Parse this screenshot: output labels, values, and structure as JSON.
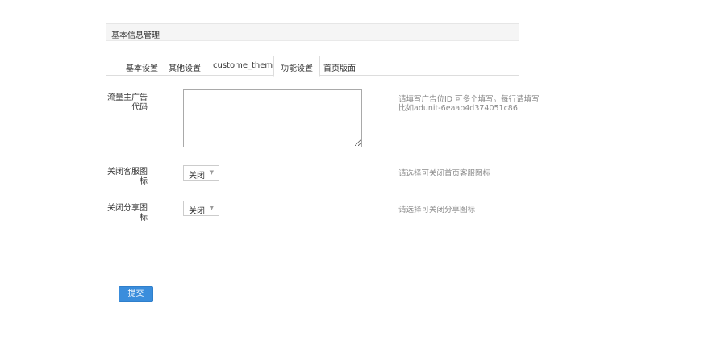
{
  "panel": {
    "title": "基本信息管理"
  },
  "tabs": [
    {
      "label": "基本设置"
    },
    {
      "label": "其他设置"
    },
    {
      "label": "custome_theme"
    },
    {
      "label": "功能设置"
    },
    {
      "label": "首页版面"
    }
  ],
  "active_tab": "功能设置",
  "form": {
    "ad_code": {
      "label_line1": "流量主广告",
      "label_line2": "代码",
      "value": "",
      "help_line1": "请填写广告位ID 可多个填写。每行请填写",
      "help_line2": "比如adunit-6eaab4d374051c86"
    },
    "close_service": {
      "label_line1": "关闭客服图",
      "label_line2": "标",
      "selected": "关闭",
      "help": "请选择可关闭首页客服图标"
    },
    "close_share": {
      "label_line1": "关闭分享图",
      "label_line2": "标",
      "selected": "关闭",
      "help": "请选择可关闭分享图标"
    }
  },
  "submit_label": "提交",
  "colors": {
    "primary_button": "#3a8ddc",
    "help_text": "#8a8a8a"
  }
}
